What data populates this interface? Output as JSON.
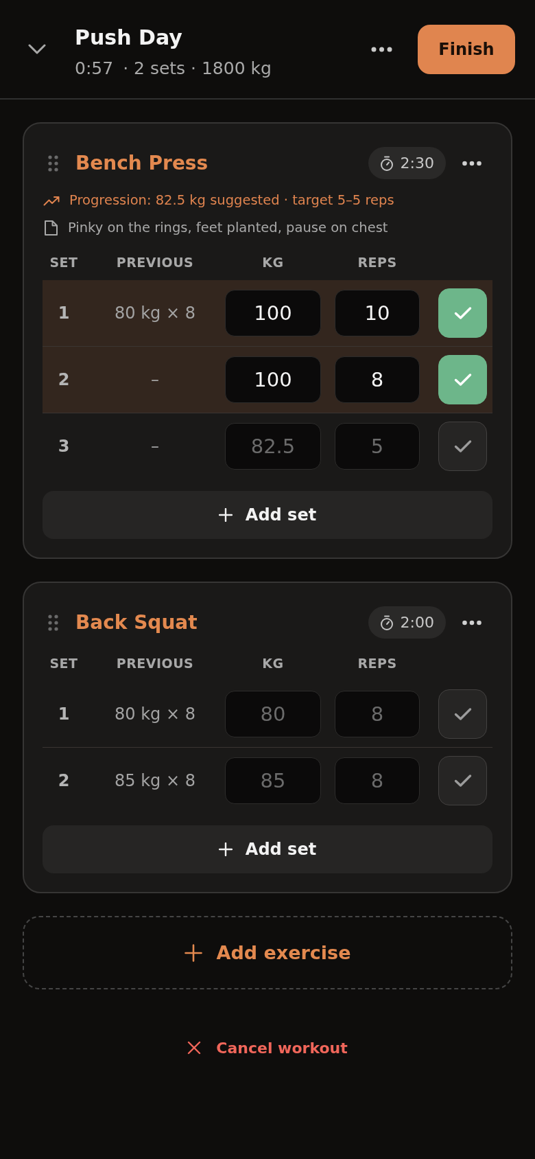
{
  "header": {
    "title": "Push Day",
    "elapsed": "0:57",
    "summary": "· 2 sets · 1800 kg",
    "finish_label": "Finish"
  },
  "exercises": [
    {
      "name": "Bench Press",
      "rest_timer": "2:30",
      "progression": "Progression: 82.5 kg suggested · target 5–5 reps",
      "note": "Pinky on the rings, feet planted, pause on chest",
      "columns": [
        "SET",
        "PREVIOUS",
        "KG",
        "REPS"
      ],
      "sets": [
        {
          "set": "1",
          "previous": "80 kg × 8",
          "kg": {
            "value": "100"
          },
          "reps": {
            "value": "10"
          },
          "completed": true
        },
        {
          "set": "2",
          "previous": "–",
          "kg": {
            "value": "100"
          },
          "reps": {
            "value": "8"
          },
          "completed": true
        },
        {
          "set": "3",
          "previous": "–",
          "kg": {
            "placeholder": "82.5"
          },
          "reps": {
            "placeholder": "5"
          },
          "completed": false
        }
      ],
      "add_set_label": "Add set"
    },
    {
      "name": "Back Squat",
      "rest_timer": "2:00",
      "columns": [
        "SET",
        "PREVIOUS",
        "KG",
        "REPS"
      ],
      "sets": [
        {
          "set": "1",
          "previous": "80 kg × 8",
          "kg": {
            "placeholder": "80"
          },
          "reps": {
            "placeholder": "8"
          },
          "completed": false
        },
        {
          "set": "2",
          "previous": "85 kg × 8",
          "kg": {
            "placeholder": "85"
          },
          "reps": {
            "placeholder": "8"
          },
          "completed": false
        }
      ],
      "add_set_label": "Add set"
    }
  ],
  "add_exercise_label": "Add exercise",
  "cancel_label": "Cancel workout"
}
